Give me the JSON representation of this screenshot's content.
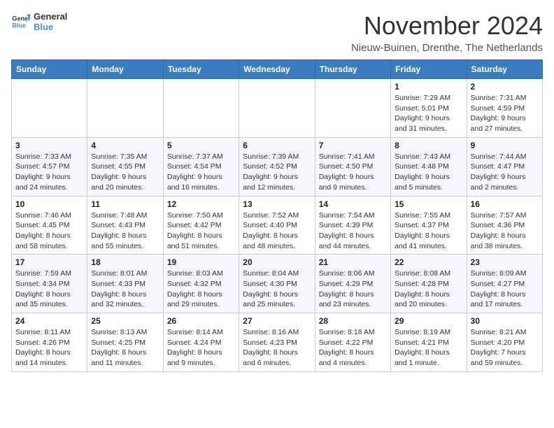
{
  "header": {
    "logo_line1": "General",
    "logo_line2": "Blue",
    "month_title": "November 2024",
    "subtitle": "Nieuw-Buinen, Drenthe, The Netherlands"
  },
  "days_of_week": [
    "Sunday",
    "Monday",
    "Tuesday",
    "Wednesday",
    "Thursday",
    "Friday",
    "Saturday"
  ],
  "weeks": [
    [
      {
        "day": "",
        "info": ""
      },
      {
        "day": "",
        "info": ""
      },
      {
        "day": "",
        "info": ""
      },
      {
        "day": "",
        "info": ""
      },
      {
        "day": "",
        "info": ""
      },
      {
        "day": "1",
        "info": "Sunrise: 7:29 AM\nSunset: 5:01 PM\nDaylight: 9 hours and 31 minutes."
      },
      {
        "day": "2",
        "info": "Sunrise: 7:31 AM\nSunset: 4:59 PM\nDaylight: 9 hours and 27 minutes."
      }
    ],
    [
      {
        "day": "3",
        "info": "Sunrise: 7:33 AM\nSunset: 4:57 PM\nDaylight: 9 hours and 24 minutes."
      },
      {
        "day": "4",
        "info": "Sunrise: 7:35 AM\nSunset: 4:55 PM\nDaylight: 9 hours and 20 minutes."
      },
      {
        "day": "5",
        "info": "Sunrise: 7:37 AM\nSunset: 4:54 PM\nDaylight: 9 hours and 16 minutes."
      },
      {
        "day": "6",
        "info": "Sunrise: 7:39 AM\nSunset: 4:52 PM\nDaylight: 9 hours and 12 minutes."
      },
      {
        "day": "7",
        "info": "Sunrise: 7:41 AM\nSunset: 4:50 PM\nDaylight: 9 hours and 9 minutes."
      },
      {
        "day": "8",
        "info": "Sunrise: 7:43 AM\nSunset: 4:48 PM\nDaylight: 9 hours and 5 minutes."
      },
      {
        "day": "9",
        "info": "Sunrise: 7:44 AM\nSunset: 4:47 PM\nDaylight: 9 hours and 2 minutes."
      }
    ],
    [
      {
        "day": "10",
        "info": "Sunrise: 7:46 AM\nSunset: 4:45 PM\nDaylight: 8 hours and 58 minutes."
      },
      {
        "day": "11",
        "info": "Sunrise: 7:48 AM\nSunset: 4:43 PM\nDaylight: 8 hours and 55 minutes."
      },
      {
        "day": "12",
        "info": "Sunrise: 7:50 AM\nSunset: 4:42 PM\nDaylight: 8 hours and 51 minutes."
      },
      {
        "day": "13",
        "info": "Sunrise: 7:52 AM\nSunset: 4:40 PM\nDaylight: 8 hours and 48 minutes."
      },
      {
        "day": "14",
        "info": "Sunrise: 7:54 AM\nSunset: 4:39 PM\nDaylight: 8 hours and 44 minutes."
      },
      {
        "day": "15",
        "info": "Sunrise: 7:55 AM\nSunset: 4:37 PM\nDaylight: 8 hours and 41 minutes."
      },
      {
        "day": "16",
        "info": "Sunrise: 7:57 AM\nSunset: 4:36 PM\nDaylight: 8 hours and 38 minutes."
      }
    ],
    [
      {
        "day": "17",
        "info": "Sunrise: 7:59 AM\nSunset: 4:34 PM\nDaylight: 8 hours and 35 minutes."
      },
      {
        "day": "18",
        "info": "Sunrise: 8:01 AM\nSunset: 4:33 PM\nDaylight: 8 hours and 32 minutes."
      },
      {
        "day": "19",
        "info": "Sunrise: 8:03 AM\nSunset: 4:32 PM\nDaylight: 8 hours and 29 minutes."
      },
      {
        "day": "20",
        "info": "Sunrise: 8:04 AM\nSunset: 4:30 PM\nDaylight: 8 hours and 25 minutes."
      },
      {
        "day": "21",
        "info": "Sunrise: 8:06 AM\nSunset: 4:29 PM\nDaylight: 8 hours and 23 minutes."
      },
      {
        "day": "22",
        "info": "Sunrise: 8:08 AM\nSunset: 4:28 PM\nDaylight: 8 hours and 20 minutes."
      },
      {
        "day": "23",
        "info": "Sunrise: 8:09 AM\nSunset: 4:27 PM\nDaylight: 8 hours and 17 minutes."
      }
    ],
    [
      {
        "day": "24",
        "info": "Sunrise: 8:11 AM\nSunset: 4:26 PM\nDaylight: 8 hours and 14 minutes."
      },
      {
        "day": "25",
        "info": "Sunrise: 8:13 AM\nSunset: 4:25 PM\nDaylight: 8 hours and 11 minutes."
      },
      {
        "day": "26",
        "info": "Sunrise: 8:14 AM\nSunset: 4:24 PM\nDaylight: 8 hours and 9 minutes."
      },
      {
        "day": "27",
        "info": "Sunrise: 8:16 AM\nSunset: 4:23 PM\nDaylight: 8 hours and 6 minutes."
      },
      {
        "day": "28",
        "info": "Sunrise: 8:18 AM\nSunset: 4:22 PM\nDaylight: 8 hours and 4 minutes."
      },
      {
        "day": "29",
        "info": "Sunrise: 8:19 AM\nSunset: 4:21 PM\nDaylight: 8 hours and 1 minute."
      },
      {
        "day": "30",
        "info": "Sunrise: 8:21 AM\nSunset: 4:20 PM\nDaylight: 7 hours and 59 minutes."
      }
    ]
  ]
}
